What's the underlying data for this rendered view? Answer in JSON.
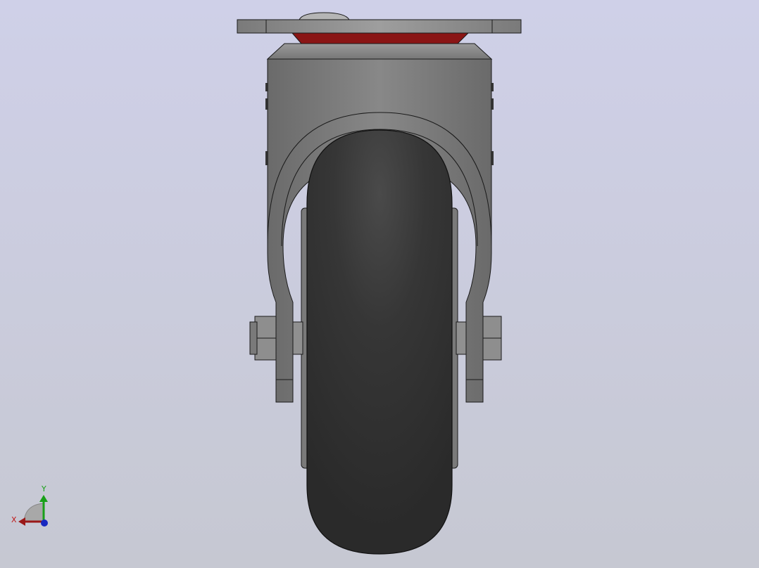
{
  "viewport": {
    "model": "caster-wheel-front-view",
    "background_top": "#cfd0e8",
    "background_bottom": "#c6c8d2"
  },
  "colors": {
    "tire": "#2e2e2e",
    "metal_light": "#a0a0a0",
    "metal_mid": "#7c7c7c",
    "metal_dark": "#555555",
    "bearing_red": "#8a1515",
    "outline": "#1a1a1a"
  },
  "triad": {
    "x_label": "X",
    "y_label": "Y",
    "x_color": "#c01818",
    "y_color": "#18a018",
    "z_color": "#1828c0"
  }
}
